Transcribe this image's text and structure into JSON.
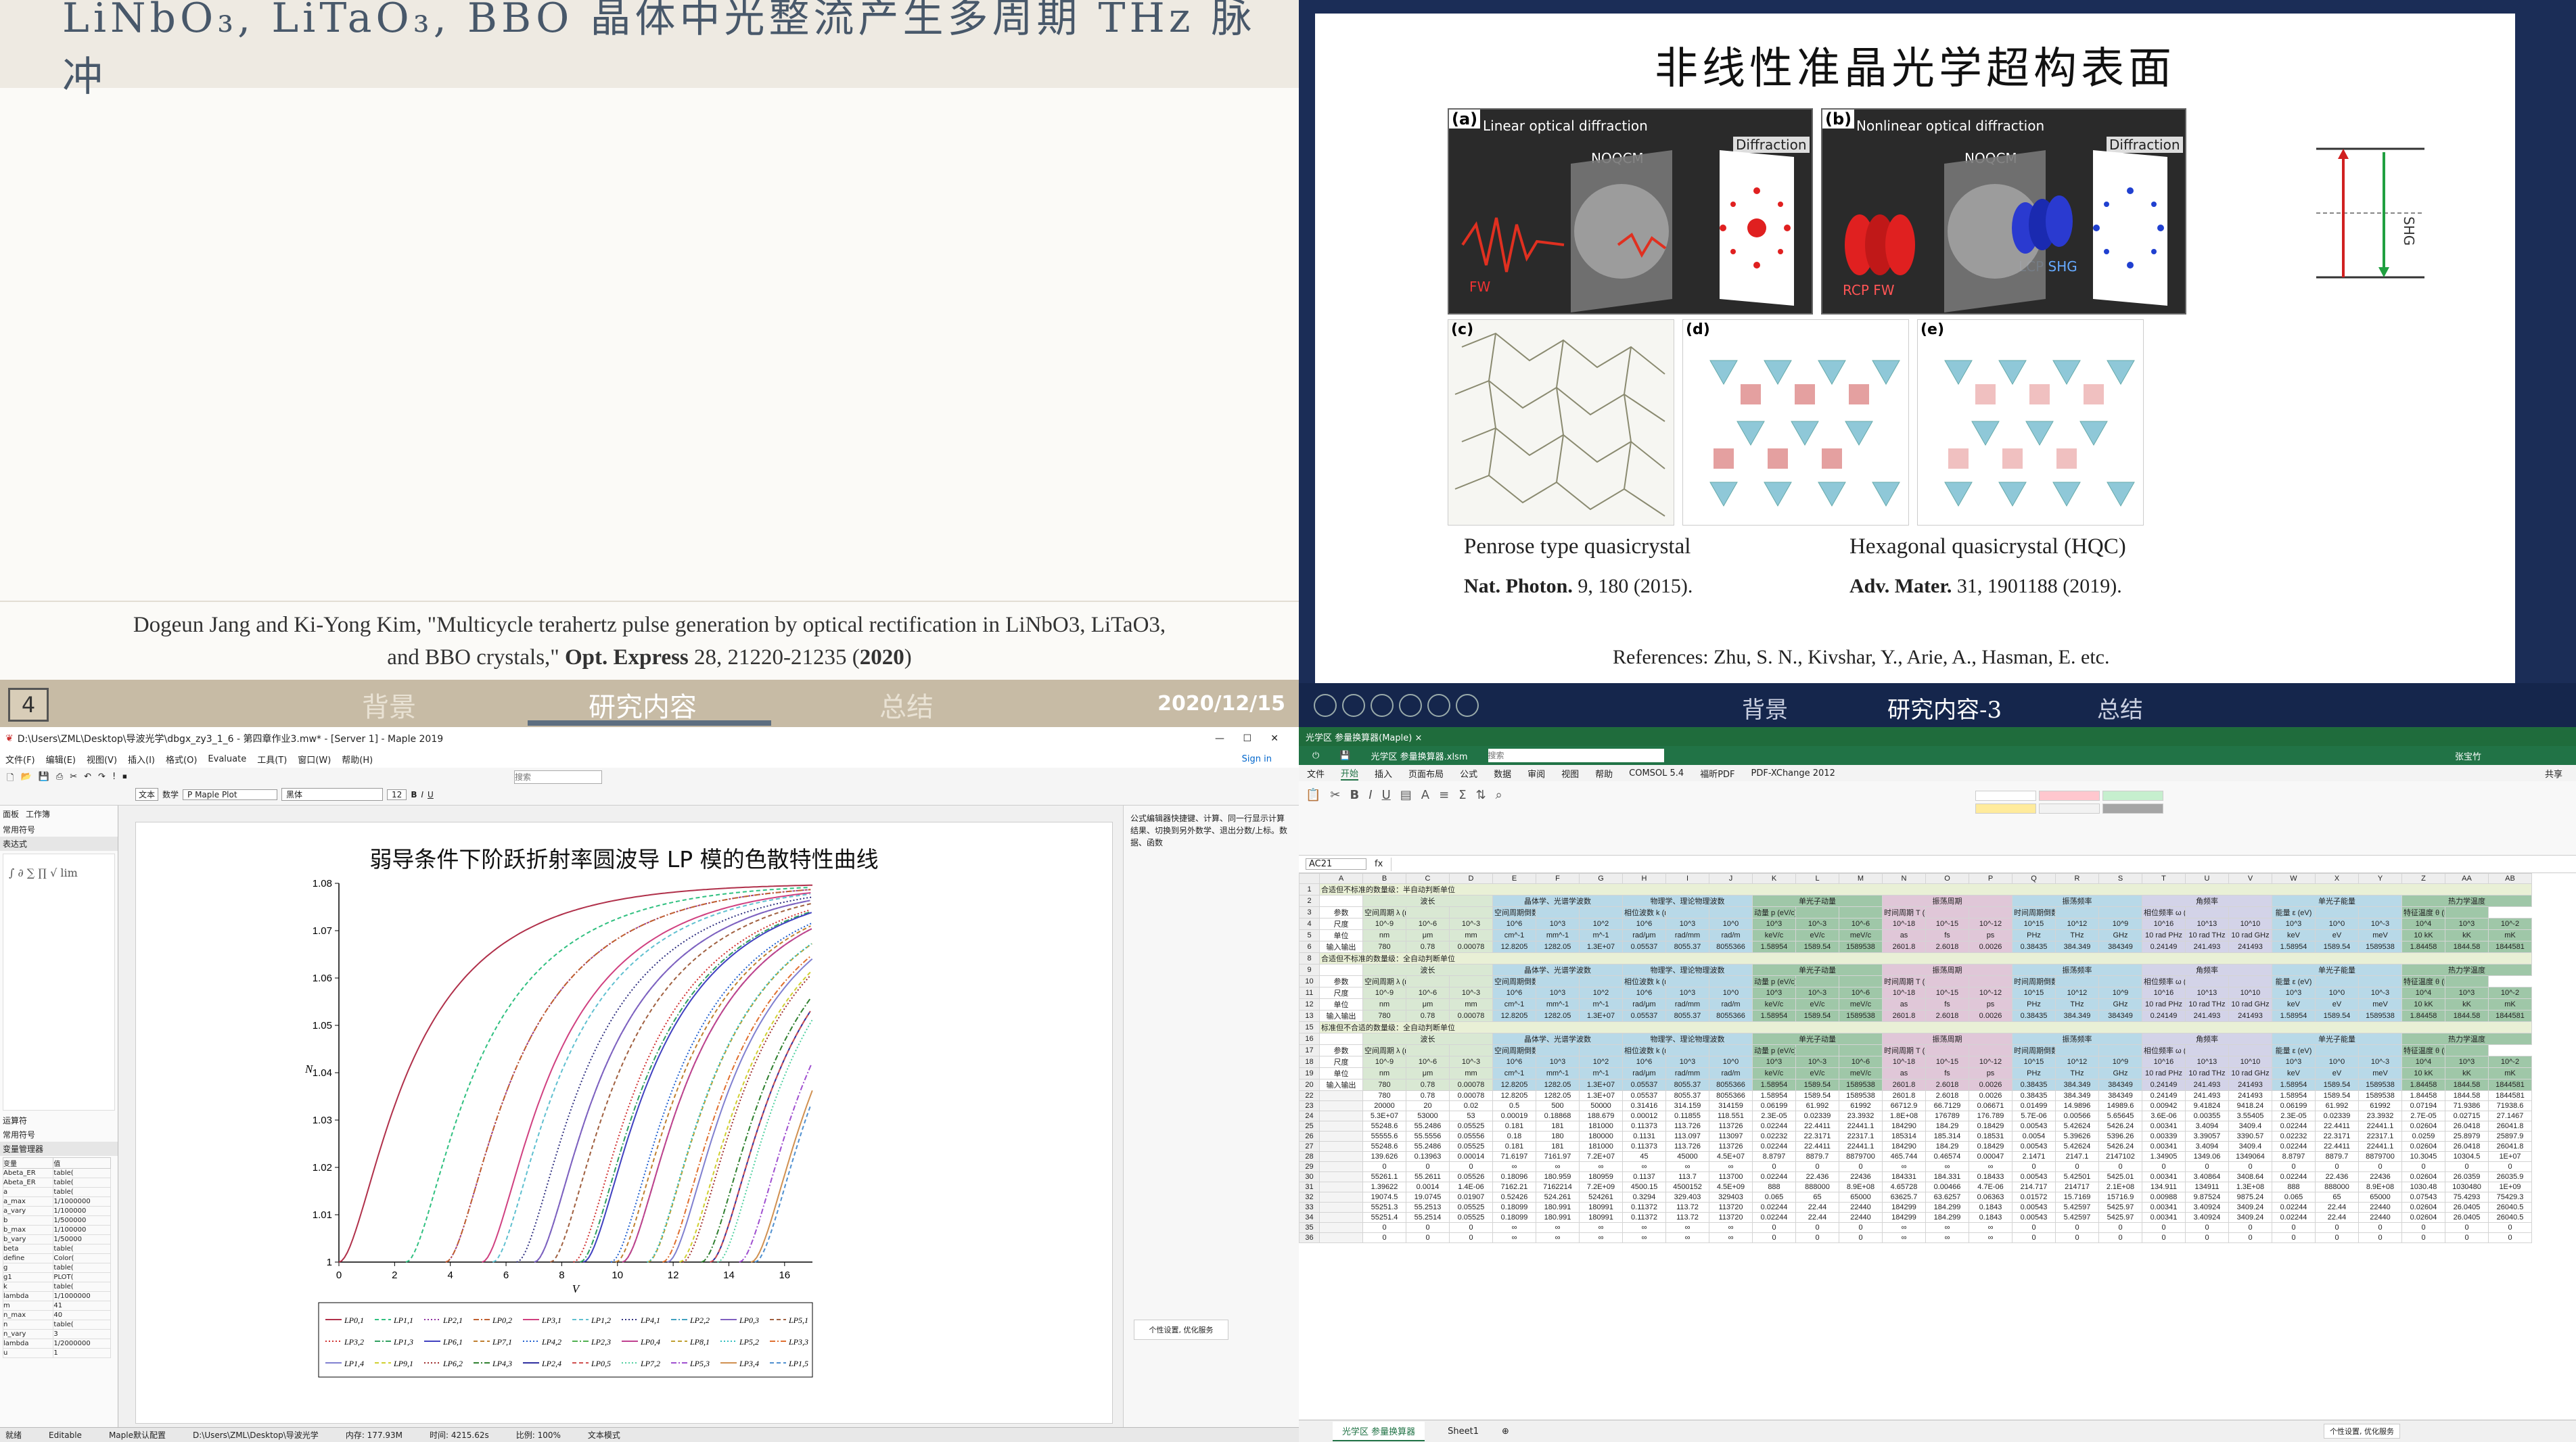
{
  "slide1": {
    "title": "LiNbO₃, LiTaO₃, BBO 晶体中光整流产生多周期 THz 脉冲",
    "citation_line1": "Dogeun Jang and Ki-Yong Kim, \"Multicycle terahertz pulse generation by optical rectification in LiNbO3, LiTaO3,",
    "citation_line2_a": "and BBO crystals,\" ",
    "citation_journal": "Opt. Express",
    "citation_line2_b": " 28, 21220-21235 (",
    "citation_year": "2020",
    "citation_end": ")",
    "slide_number": "4",
    "tabs": [
      "背景",
      "研究内容",
      "总结"
    ],
    "date": "2020/12/15"
  },
  "slide2": {
    "title": "非线性准晶光学超构表面",
    "panel_a": {
      "label": "(a)",
      "text": "Linear optical diffraction",
      "noqcm": "NOQCM",
      "diffraction": "Diffraction",
      "fw": "FW"
    },
    "panel_b": {
      "label": "(b)",
      "text": "Nonlinear optical diffraction",
      "noqcm": "NOQCM",
      "diffraction": "Diffraction",
      "rcp": "RCP FW",
      "lcp": "LCP SHG"
    },
    "panel_labels": [
      "(c)",
      "(d)",
      "(e)"
    ],
    "shg_label": "SHG",
    "caption_left": "Penrose type quasicrystal",
    "caption_right": "Hexagonal quasicrystal (HQC)",
    "ref_left_journal": "Nat. Photon.",
    "ref_left_rest": " 9, 180 (2015).",
    "ref_right_journal": "Adv. Mater.",
    "ref_right_rest": " 31, 1901188 (2019).",
    "references": "References: Zhu, S. N., Kivshar, Y., Arie, A., Hasman, E. etc.",
    "tabs": [
      "背景",
      "研究内容-3",
      "总结"
    ]
  },
  "maple": {
    "window_title": "D:\\Users\\ZML\\Desktop\\导波光学\\dbgx_zy3_1_6 - 第四章作业3.mw* - [Server 1] - Maple 2019",
    "menu": [
      "文件(F)",
      "编辑(E)",
      "视图(V)",
      "插入(I)",
      "格式(O)",
      "Evaluate",
      "工具(T)",
      "窗口(W)",
      "帮助(H)"
    ],
    "sign_in": "Sign in",
    "search_placeholder": "搜索",
    "side_title": "面板",
    "side_workspace": "工作簿",
    "side_sections": [
      "常用符号",
      "表达式"
    ],
    "side_bottom_sections": [
      "运算符",
      "常用符号",
      "变量管理器"
    ],
    "variable_header": [
      "变量",
      "值"
    ],
    "variables": [
      [
        "Abeta_ER",
        "table("
      ],
      [
        "Abeta_ER",
        "table("
      ],
      [
        "a",
        "table("
      ],
      [
        "a_max",
        "1/1000000"
      ],
      [
        "a_vary",
        "1/100000"
      ],
      [
        "b",
        "1/500000"
      ],
      [
        "b_max",
        "1/100000"
      ],
      [
        "b_vary",
        "1/50000"
      ],
      [
        "beta",
        "table("
      ],
      [
        "define",
        "Color("
      ],
      [
        "g",
        "table("
      ],
      [
        "g1",
        "PLOT("
      ],
      [
        "k",
        "table("
      ],
      [
        "lambda",
        "1/1000000"
      ],
      [
        "m",
        "41"
      ],
      [
        "n_max",
        "40"
      ],
      [
        "n",
        "table("
      ],
      [
        "n_vary",
        "3"
      ],
      [
        "lambda",
        "1/2000000"
      ],
      [
        "u",
        "1"
      ]
    ],
    "text_mode": "文本",
    "math_mode": "数学",
    "style": "P Maple Plot",
    "font": "黑体",
    "size": "12",
    "right_panel_text": "公式编辑器快捷键、计算、同一行显示计算结果、切换到另外数学、退出分数/上标。数据、函数",
    "chart_title_label": "弱导条件下阶跃折射率圆波导 LP 模的色散特性曲线",
    "status_items": [
      "就绪",
      "Editable",
      "Maple默认配置",
      "D:\\Users\\ZML\\Desktop\\导波光学",
      "内存: 177.93M",
      "时间: 4215.62s",
      "比例: 100%",
      "文本模式"
    ],
    "dialog_text": "个性设置, 优化服务"
  },
  "chart_data": {
    "type": "line",
    "title": "弱导条件下阶跃折射率圆波导 LP 模的色散特性曲线",
    "xlabel": "V",
    "ylabel": "N",
    "xlim": [
      0,
      17
    ],
    "ylim": [
      1,
      1.08
    ],
    "xticks": [
      0,
      2,
      4,
      6,
      8,
      10,
      12,
      14,
      16
    ],
    "yticks": [
      1,
      1.01,
      1.02,
      1.03,
      1.04,
      1.05,
      1.06,
      1.07,
      1.08
    ],
    "grid": false,
    "legend_position": "bottom",
    "series": [
      {
        "name": "LP0,1",
        "color": "#b0304a",
        "cutoff": 0.0
      },
      {
        "name": "LP1,1",
        "color": "#30c080",
        "cutoff": 2.405
      },
      {
        "name": "LP2,1",
        "color": "#9030a0",
        "cutoff": 3.832
      },
      {
        "name": "LP0,2",
        "color": "#c06030",
        "cutoff": 3.832
      },
      {
        "name": "LP3,1",
        "color": "#d04080",
        "cutoff": 5.136
      },
      {
        "name": "LP1,2",
        "color": "#60c0d0",
        "cutoff": 5.52
      },
      {
        "name": "LP4,1",
        "color": "#303080",
        "cutoff": 6.38
      },
      {
        "name": "LP2,2",
        "color": "#40a0c0",
        "cutoff": 7.016
      },
      {
        "name": "LP0,3",
        "color": "#8060c0",
        "cutoff": 7.016
      },
      {
        "name": "LP5,1",
        "color": "#a06040",
        "cutoff": 7.588
      },
      {
        "name": "LP3,2",
        "color": "#d03030",
        "cutoff": 8.417
      },
      {
        "name": "LP1,3",
        "color": "#30a060",
        "cutoff": 8.654
      },
      {
        "name": "LP6,1",
        "color": "#4040c0",
        "cutoff": 8.771
      },
      {
        "name": "LP7,1",
        "color": "#c08030",
        "cutoff": 9.936
      },
      {
        "name": "LP4,2",
        "color": "#2060d0",
        "cutoff": 9.761
      },
      {
        "name": "LP2,3",
        "color": "#50b050",
        "cutoff": 10.173
      },
      {
        "name": "LP0,4",
        "color": "#c04090",
        "cutoff": 10.173
      },
      {
        "name": "LP8,1",
        "color": "#c0a030",
        "cutoff": 11.086
      },
      {
        "name": "LP5,2",
        "color": "#30c0c0",
        "cutoff": 11.065
      },
      {
        "name": "LP3,3",
        "color": "#e07030",
        "cutoff": 11.62
      },
      {
        "name": "LP1,4",
        "color": "#8080d0",
        "cutoff": 11.792
      },
      {
        "name": "LP9,1",
        "color": "#d0d030",
        "cutoff": 12.225
      },
      {
        "name": "LP6,2",
        "color": "#a03030",
        "cutoff": 12.339
      },
      {
        "name": "LP4,3",
        "color": "#308030",
        "cutoff": 13.015
      },
      {
        "name": "LP2,4",
        "color": "#3030a0",
        "cutoff": 13.324
      },
      {
        "name": "LP0,5",
        "color": "#d05050",
        "cutoff": 13.324
      },
      {
        "name": "LP7,2",
        "color": "#50d0a0",
        "cutoff": 13.589
      },
      {
        "name": "LP5,3",
        "color": "#a050d0",
        "cutoff": 14.373
      },
      {
        "name": "LP3,4",
        "color": "#d09050",
        "cutoff": 14.796
      },
      {
        "name": "LP1,5",
        "color": "#5090d0",
        "cutoff": 14.931
      }
    ]
  },
  "excel": {
    "window_title": "光学区 参量换算器(Maple) ×",
    "file_title": "光学区 参量换算器.xlsm",
    "search_placeholder": "搜索",
    "user": "张宝竹",
    "ribbon_tabs": [
      "文件",
      "开始",
      "插入",
      "页面布局",
      "公式",
      "数据",
      "审阅",
      "视图",
      "帮助",
      "COMSOL 5.4",
      "福昕PDF",
      "PDF-XChange 2012"
    ],
    "share": "共享",
    "name_box": "AC21",
    "columns": [
      "A",
      "B",
      "C",
      "D",
      "E",
      "F",
      "G",
      "H",
      "I",
      "J",
      "K",
      "L",
      "M",
      "N",
      "O",
      "P",
      "Q",
      "R",
      "S",
      "T",
      "U",
      "V",
      "W",
      "X",
      "Y",
      "Z",
      "AA",
      "AB"
    ],
    "section_titles": [
      "合适但不标准的数量级：半自动判断单位",
      "合适但不标准的数量级：全自动判断单位",
      "标准但不合适的数量级：全自动判断单位"
    ],
    "header_groups": [
      "波长",
      "晶体学、光谱学波数",
      "物理学、理论物理波数",
      "单光子动量",
      "振荡周期",
      "振荡频率",
      "角频率",
      "单光子能量",
      "热力学温度"
    ],
    "rows": [
      [
        "参数",
        "空间周期 λ (m)",
        "",
        "",
        "空间周期倒数 ṽ (m^-1)",
        "",
        "",
        "相位波数 k (rad/m)",
        "",
        "",
        "动量 p (eV/c)",
        "",
        "",
        "时间周期 T (s)",
        "",
        "",
        "时间周期倒数 f (Hz)",
        "",
        "",
        "相位频率 ω (rad/Hz)",
        "",
        "",
        "能量 ε (eV)",
        "",
        "",
        "特征温度 θ (K)",
        ""
      ],
      [
        "尺度",
        "10^-9",
        "10^-6",
        "10^-3",
        "10^6",
        "10^3",
        "10^2",
        "10^6",
        "10^3",
        "10^0",
        "10^3",
        "10^-3",
        "10^-6",
        "10^-18",
        "10^-15",
        "10^-12",
        "10^15",
        "10^12",
        "10^9",
        "10^16",
        "10^13",
        "10^10",
        "10^3",
        "10^0",
        "10^-3",
        "10^4",
        "10^3",
        "10^-2"
      ],
      [
        "单位",
        "nm",
        "μm",
        "mm",
        "cm^-1",
        "mm^-1",
        "m^-1",
        "rad/μm",
        "rad/mm",
        "rad/m",
        "keV/c",
        "eV/c",
        "meV/c",
        "as",
        "fs",
        "ps",
        "PHz",
        "THz",
        "GHz",
        "10 rad PHz",
        "10 rad THz",
        "10 rad GHz",
        "keV",
        "eV",
        "meV",
        "10 kK",
        "kK",
        "mK"
      ],
      [
        "输入输出",
        "780",
        "0.78",
        "0.00078",
        "12.8205",
        "1282.05",
        "1.3E+07",
        "0.05537",
        "8055.37",
        "8055366",
        "1.58954",
        "1589.54",
        "1589538",
        "2601.8",
        "2.6018",
        "0.0026",
        "0.38435",
        "384.349",
        "384349",
        "0.24149",
        "241.493",
        "241493",
        "1.58954",
        "1589.54",
        "1589538",
        "1.84458",
        "1844.58",
        "1844581"
      ],
      [
        "",
        "780",
        "0.78",
        "0.00078",
        "12.8205",
        "1282.05",
        "1.3E+07",
        "0.05537",
        "8055.37",
        "8055366",
        "1.58954",
        "1589.54",
        "1589538",
        "2601.8",
        "2.6018",
        "0.0026",
        "0.38435",
        "384.349",
        "384349",
        "0.24149",
        "241.493",
        "241493",
        "1.58954",
        "1589.54",
        "1589538",
        "1.84458",
        "1844.58",
        "1844581"
      ],
      [
        "",
        "20000",
        "20",
        "0.02",
        "0.5",
        "500",
        "50000",
        "0.31416",
        "314.159",
        "314159",
        "0.06199",
        "61.992",
        "61992",
        "66712.9",
        "66.7129",
        "0.06671",
        "0.01499",
        "14.9896",
        "14989.6",
        "0.00942",
        "9.41824",
        "9418.24",
        "0.06199",
        "61.992",
        "61992",
        "0.07194",
        "71.9386",
        "71938.6"
      ],
      [
        "",
        "5.3E+07",
        "53000",
        "53",
        "0.00019",
        "0.18868",
        "188.679",
        "0.00012",
        "0.11855",
        "118.551",
        "2.3E-05",
        "0.02339",
        "23.3932",
        "1.8E+08",
        "176789",
        "176.789",
        "5.7E-06",
        "0.00566",
        "5.65645",
        "3.6E-06",
        "0.00355",
        "3.55405",
        "2.3E-05",
        "0.02339",
        "23.3932",
        "2.7E-05",
        "0.02715",
        "27.1467"
      ],
      [
        "",
        "55248.6",
        "55.2486",
        "0.05525",
        "0.181",
        "181",
        "181000",
        "0.11373",
        "113.726",
        "113726",
        "0.02244",
        "22.4411",
        "22441.1",
        "184290",
        "184.29",
        "0.18429",
        "0.00543",
        "5.42624",
        "5426.24",
        "0.00341",
        "3.4094",
        "3409.4",
        "0.02244",
        "22.4411",
        "22441.1",
        "0.02604",
        "26.0418",
        "26041.8"
      ],
      [
        "",
        "55555.6",
        "55.5556",
        "0.05556",
        "0.18",
        "180",
        "180000",
        "0.1131",
        "113.097",
        "113097",
        "0.02232",
        "22.3171",
        "22317.1",
        "185314",
        "185.314",
        "0.18531",
        "0.0054",
        "5.39626",
        "5396.26",
        "0.00339",
        "3.39057",
        "3390.57",
        "0.02232",
        "22.3171",
        "22317.1",
        "0.0259",
        "25.8979",
        "25897.9"
      ],
      [
        "",
        "55248.6",
        "55.2486",
        "0.05525",
        "0.181",
        "181",
        "181000",
        "0.11373",
        "113.726",
        "113726",
        "0.02244",
        "22.4411",
        "22441.1",
        "184290",
        "184.29",
        "0.18429",
        "0.00543",
        "5.42624",
        "5426.24",
        "0.00341",
        "3.4094",
        "3409.4",
        "0.02244",
        "22.4411",
        "22441.1",
        "0.02604",
        "26.0418",
        "26041.8"
      ],
      [
        "",
        "139.626",
        "0.13963",
        "0.00014",
        "71.6197",
        "7161.97",
        "7.2E+07",
        "45",
        "45000",
        "4.5E+07",
        "8.8797",
        "8879.7",
        "8879700",
        "465.744",
        "0.46574",
        "0.00047",
        "2.1471",
        "2147.1",
        "2147102",
        "1.34905",
        "1349.06",
        "1349064",
        "8.8797",
        "8879.7",
        "8879700",
        "10.3045",
        "10304.5",
        "1E+07"
      ],
      [
        "",
        "0",
        "0",
        "0",
        "∞",
        "∞",
        "∞",
        "∞",
        "∞",
        "∞",
        "0",
        "0",
        "0",
        "∞",
        "∞",
        "∞",
        "0",
        "0",
        "0",
        "0",
        "0",
        "0",
        "0",
        "0",
        "0",
        "0",
        "0",
        "0"
      ],
      [
        "",
        "55261.1",
        "55.2611",
        "0.05526",
        "0.18096",
        "180.959",
        "180959",
        "0.1137",
        "113.7",
        "113700",
        "0.02244",
        "22.436",
        "22436",
        "184331",
        "184.331",
        "0.18433",
        "0.00543",
        "5.42501",
        "5425.01",
        "0.00341",
        "3.40864",
        "3408.64",
        "0.02244",
        "22.436",
        "22436",
        "0.02604",
        "26.0359",
        "26035.9"
      ],
      [
        "",
        "1.39622",
        "0.0014",
        "1.4E-06",
        "7162.21",
        "7162214",
        "7.2E+09",
        "4500.15",
        "4500152",
        "4.5E+09",
        "888",
        "888000",
        "8.9E+08",
        "4.65728",
        "0.00466",
        "4.7E-06",
        "214.717",
        "214717",
        "2.1E+08",
        "134.911",
        "134911",
        "1.3E+08",
        "888",
        "888000",
        "8.9E+08",
        "1030.48",
        "1030480",
        "1E+09"
      ],
      [
        "",
        "19074.5",
        "19.0745",
        "0.01907",
        "0.52426",
        "524.261",
        "524261",
        "0.3294",
        "329.403",
        "329403",
        "0.065",
        "65",
        "65000",
        "63625.7",
        "63.6257",
        "0.06363",
        "0.01572",
        "15.7169",
        "15716.9",
        "0.00988",
        "9.87524",
        "9875.24",
        "0.065",
        "65",
        "65000",
        "0.07543",
        "75.4293",
        "75429.3"
      ],
      [
        "",
        "55251.3",
        "55.2513",
        "0.05525",
        "0.18099",
        "180.991",
        "180991",
        "0.11372",
        "113.72",
        "113720",
        "0.02244",
        "22.44",
        "22440",
        "184299",
        "184.299",
        "0.1843",
        "0.00543",
        "5.42597",
        "5425.97",
        "0.00341",
        "3.40924",
        "3409.24",
        "0.02244",
        "22.44",
        "22440",
        "0.02604",
        "26.0405",
        "26040.5"
      ],
      [
        "",
        "55251.4",
        "55.2514",
        "0.05525",
        "0.18099",
        "180.991",
        "180991",
        "0.11372",
        "113.72",
        "113720",
        "0.02244",
        "22.44",
        "22440",
        "184299",
        "184.299",
        "0.1843",
        "0.00543",
        "5.42597",
        "5425.97",
        "0.00341",
        "3.40924",
        "3409.24",
        "0.02244",
        "22.44",
        "22440",
        "0.02604",
        "26.0405",
        "26040.5"
      ],
      [
        "",
        "0",
        "0",
        "0",
        "∞",
        "∞",
        "∞",
        "∞",
        "∞",
        "∞",
        "0",
        "0",
        "0",
        "∞",
        "∞",
        "∞",
        "0",
        "0",
        "0",
        "0",
        "0",
        "0",
        "0",
        "0",
        "0",
        "0",
        "0",
        "0"
      ],
      [
        "",
        "0",
        "0",
        "0",
        "∞",
        "∞",
        "∞",
        "∞",
        "∞",
        "∞",
        "0",
        "0",
        "0",
        "∞",
        "∞",
        "∞",
        "0",
        "0",
        "0",
        "0",
        "0",
        "0",
        "0",
        "0",
        "0",
        "0",
        "0",
        "0"
      ]
    ],
    "sheet_tabs": [
      "光学区 参量换算器",
      "Sheet1"
    ],
    "status_ready": "就绪",
    "dialog_text": "个性设置, 优化服务"
  }
}
